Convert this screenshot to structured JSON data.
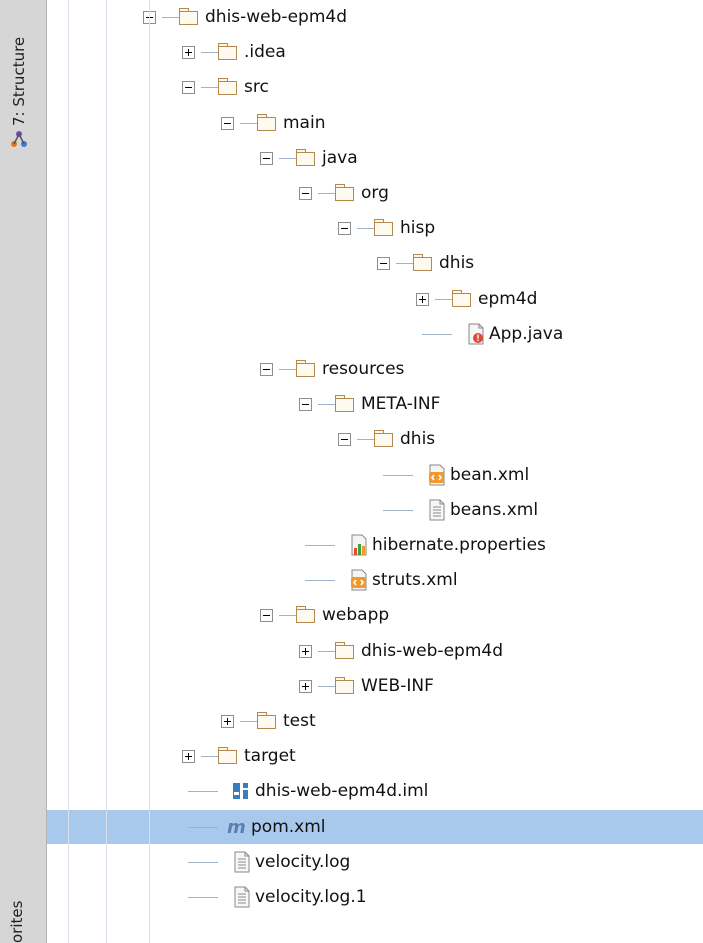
{
  "side_panel": {
    "structure_tab": "7: Structure",
    "favorites_tab": "orites"
  },
  "tree": {
    "items": [
      {
        "label": "dhis-web-epm4d",
        "type": "folder",
        "toggle": "minus"
      },
      {
        "label": ".idea",
        "type": "folder",
        "toggle": "plus"
      },
      {
        "label": "src",
        "type": "folder",
        "toggle": "minus"
      },
      {
        "label": "main",
        "type": "folder",
        "toggle": "minus"
      },
      {
        "label": "java",
        "type": "folder",
        "toggle": "minus"
      },
      {
        "label": "org",
        "type": "folder",
        "toggle": "minus"
      },
      {
        "label": "hisp",
        "type": "folder",
        "toggle": "minus"
      },
      {
        "label": "dhis",
        "type": "folder",
        "toggle": "minus"
      },
      {
        "label": "epm4d",
        "type": "folder",
        "toggle": "plus"
      },
      {
        "label": "App.java",
        "type": "java-file-icon"
      },
      {
        "label": "resources",
        "type": "folder",
        "toggle": "minus"
      },
      {
        "label": "META-INF",
        "type": "folder",
        "toggle": "minus"
      },
      {
        "label": "dhis",
        "type": "folder",
        "toggle": "minus"
      },
      {
        "label": "bean.xml",
        "type": "xml-file-icon"
      },
      {
        "label": "beans.xml",
        "type": "text-file-icon"
      },
      {
        "label": "hibernate.properties",
        "type": "properties-file-icon"
      },
      {
        "label": "struts.xml",
        "type": "xml-file-icon"
      },
      {
        "label": "webapp",
        "type": "folder",
        "toggle": "minus"
      },
      {
        "label": "dhis-web-epm4d",
        "type": "folder",
        "toggle": "plus"
      },
      {
        "label": "WEB-INF",
        "type": "folder",
        "toggle": "plus"
      },
      {
        "label": "test",
        "type": "folder",
        "toggle": "plus"
      },
      {
        "label": "target",
        "type": "folder",
        "toggle": "plus"
      },
      {
        "label": "dhis-web-epm4d.iml",
        "type": "iml-file-icon"
      },
      {
        "label": "pom.xml",
        "type": "maven-file-icon",
        "selected": true
      },
      {
        "label": "velocity.log",
        "type": "text-file-icon"
      },
      {
        "label": "velocity.log.1",
        "type": "text-file-icon"
      }
    ]
  }
}
